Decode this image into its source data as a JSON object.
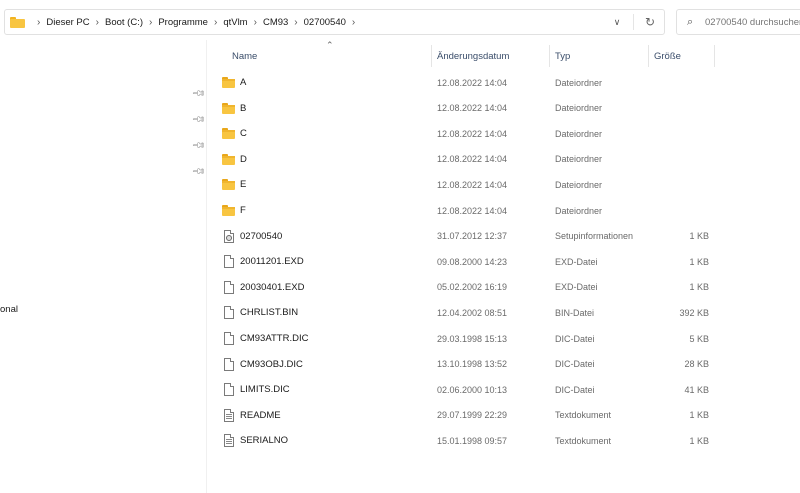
{
  "address": {
    "breadcrumbs": [
      "Dieser PC",
      "Boot (C:)",
      "Programme",
      "qtVlm",
      "CM93",
      "02700540"
    ],
    "separator": "›",
    "dropdown_icon": "chevron-down-icon",
    "refresh_icon": "refresh-icon"
  },
  "search": {
    "placeholder": "02700540 durchsuchen",
    "icon": "search-icon"
  },
  "nav": {
    "partial_label": "onal"
  },
  "columns": {
    "name": "Name",
    "date": "Änderungsdatum",
    "type": "Typ",
    "size": "Größe"
  },
  "files": [
    {
      "name": "A",
      "date": "12.08.2022 14:04",
      "type": "Dateiordner",
      "size": "",
      "icon": "folder-icon"
    },
    {
      "name": "B",
      "date": "12.08.2022 14:04",
      "type": "Dateiordner",
      "size": "",
      "icon": "folder-icon"
    },
    {
      "name": "C",
      "date": "12.08.2022 14:04",
      "type": "Dateiordner",
      "size": "",
      "icon": "folder-icon"
    },
    {
      "name": "D",
      "date": "12.08.2022 14:04",
      "type": "Dateiordner",
      "size": "",
      "icon": "folder-icon"
    },
    {
      "name": "E",
      "date": "12.08.2022 14:04",
      "type": "Dateiordner",
      "size": "",
      "icon": "folder-icon"
    },
    {
      "name": "F",
      "date": "12.08.2022 14:04",
      "type": "Dateiordner",
      "size": "",
      "icon": "folder-icon"
    },
    {
      "name": "02700540",
      "date": "31.07.2012 12:37",
      "type": "Setupinformationen",
      "size": "1 KB",
      "icon": "setup-file-icon"
    },
    {
      "name": "20011201.EXD",
      "date": "09.08.2000 14:23",
      "type": "EXD-Datei",
      "size": "1 KB",
      "icon": "file-icon"
    },
    {
      "name": "20030401.EXD",
      "date": "05.02.2002 16:19",
      "type": "EXD-Datei",
      "size": "1 KB",
      "icon": "file-icon"
    },
    {
      "name": "CHRLIST.BIN",
      "date": "12.04.2002 08:51",
      "type": "BIN-Datei",
      "size": "392 KB",
      "icon": "file-icon"
    },
    {
      "name": "CM93ATTR.DIC",
      "date": "29.03.1998 15:13",
      "type": "DIC-Datei",
      "size": "5 KB",
      "icon": "file-icon"
    },
    {
      "name": "CM93OBJ.DIC",
      "date": "13.10.1998 13:52",
      "type": "DIC-Datei",
      "size": "28 KB",
      "icon": "file-icon"
    },
    {
      "name": "LIMITS.DIC",
      "date": "02.06.2000 10:13",
      "type": "DIC-Datei",
      "size": "41 KB",
      "icon": "file-icon"
    },
    {
      "name": "README",
      "date": "29.07.1999 22:29",
      "type": "Textdokument",
      "size": "1 KB",
      "icon": "text-file-icon"
    },
    {
      "name": "SERIALNO",
      "date": "15.01.1998 09:57",
      "type": "Textdokument",
      "size": "1 KB",
      "icon": "text-file-icon"
    }
  ],
  "colors": {
    "folder": "#f8c541",
    "header_text": "#3a4d6a",
    "secondary_text": "#6a6a6a"
  }
}
